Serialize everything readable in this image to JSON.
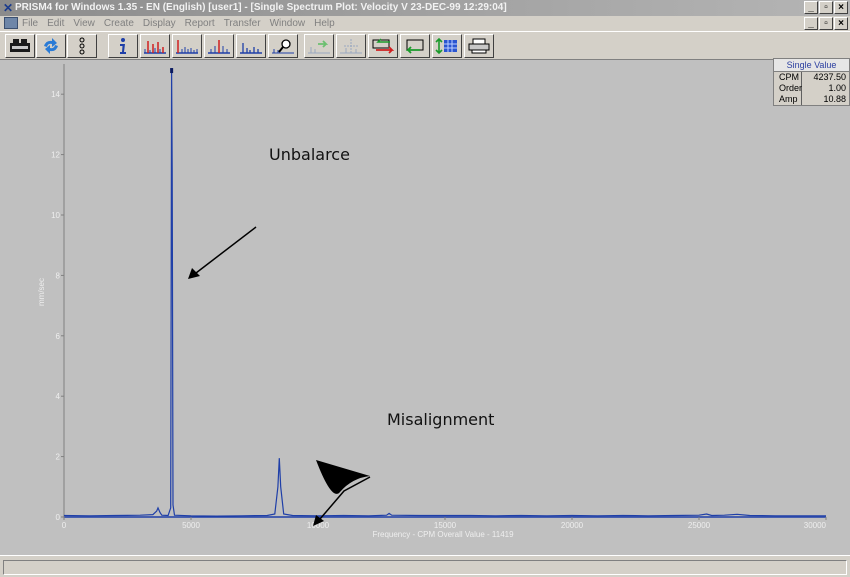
{
  "window": {
    "title": "PRISM4 for Windows 1.35 - EN (English) [user1] - [Single Spectrum Plot: Velocity V 23-DEC-99 12:29:04]",
    "min": "_",
    "max": "▫",
    "close": "×"
  },
  "menu": {
    "items": [
      "File",
      "Edit",
      "View",
      "Create",
      "Display",
      "Report",
      "Transfer",
      "Window",
      "Help"
    ]
  },
  "toolbar": {
    "buttons": [
      "database",
      "refresh",
      "tree",
      "info",
      "spectrum-peaks",
      "spectrum-harmonics",
      "spectrum-sidebands",
      "spectrum-plain",
      "zoom",
      "next",
      "cursor",
      "compare",
      "back",
      "scale",
      "print"
    ]
  },
  "single_value": {
    "title": "Single Value",
    "rows": [
      {
        "label": "CPM",
        "value": "4237.50"
      },
      {
        "label": "Order",
        "value": "1.00"
      },
      {
        "label": "Amp",
        "value": "10.88"
      }
    ]
  },
  "annotations": {
    "unbalance": "Unbalarce",
    "misalignment": "Misalignment"
  },
  "chart_data": {
    "type": "line",
    "title": "",
    "xlabel": "Frequency - CPM  Overall Value - 11419",
    "ylabel": "mm/sec",
    "xlim": [
      0,
      30000
    ],
    "ylim": [
      0,
      15
    ],
    "x_ticks": [
      0,
      5000,
      10000,
      15000,
      20000,
      25000,
      30000
    ],
    "y_ticks": [
      0,
      2,
      4,
      6,
      8,
      10,
      12,
      14
    ],
    "grid": false,
    "series": [
      {
        "color": "#1f3fa8",
        "points": [
          [
            0,
            0.05
          ],
          [
            1000,
            0.04
          ],
          [
            2000,
            0.05
          ],
          [
            3000,
            0.06
          ],
          [
            3500,
            0.08
          ],
          [
            3650,
            0.2
          ],
          [
            3700,
            0.3
          ],
          [
            3780,
            0.15
          ],
          [
            3850,
            0.06
          ],
          [
            4100,
            0.05
          ],
          [
            4200,
            0.3
          ],
          [
            4237.5,
            14.8
          ],
          [
            4260,
            11.5
          ],
          [
            4290,
            0.4
          ],
          [
            4350,
            0.06
          ],
          [
            5000,
            0.04
          ],
          [
            6000,
            0.03
          ],
          [
            7000,
            0.04
          ],
          [
            8000,
            0.05
          ],
          [
            8300,
            0.1
          ],
          [
            8420,
            1.0
          ],
          [
            8475,
            1.95
          ],
          [
            8530,
            1.0
          ],
          [
            8650,
            0.1
          ],
          [
            9000,
            0.05
          ],
          [
            10000,
            0.04
          ],
          [
            11000,
            0.05
          ],
          [
            12000,
            0.04
          ],
          [
            12700,
            0.06
          ],
          [
            12800,
            0.12
          ],
          [
            12900,
            0.06
          ],
          [
            14000,
            0.05
          ],
          [
            15000,
            0.05
          ],
          [
            16000,
            0.05
          ],
          [
            17000,
            0.04
          ],
          [
            18000,
            0.05
          ],
          [
            19000,
            0.04
          ],
          [
            20000,
            0.05
          ],
          [
            21000,
            0.04
          ],
          [
            22000,
            0.05
          ],
          [
            23000,
            0.04
          ],
          [
            24000,
            0.05
          ],
          [
            25000,
            0.06
          ],
          [
            25300,
            0.1
          ],
          [
            25500,
            0.05
          ],
          [
            26000,
            0.06
          ],
          [
            26500,
            0.09
          ],
          [
            27000,
            0.05
          ],
          [
            28000,
            0.04
          ],
          [
            29000,
            0.04
          ],
          [
            30000,
            0.04
          ]
        ]
      }
    ]
  }
}
